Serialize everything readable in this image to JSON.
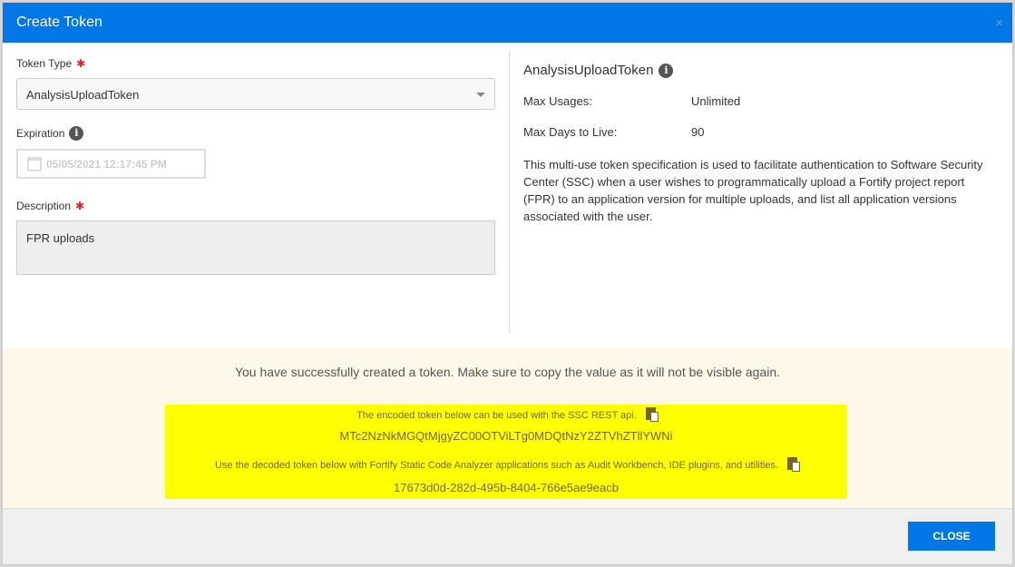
{
  "dialog": {
    "title": "Create Token",
    "close_icon": "×"
  },
  "form": {
    "token_type_label": "Token Type",
    "required_mark": "✱",
    "token_type_value": "AnalysisUploadToken",
    "expiration_label": "Expiration",
    "expiration_value": "05/05/2021 12:17:45 PM",
    "description_label": "Description",
    "description_value": "FPR uploads"
  },
  "details": {
    "title": "AnalysisUploadToken",
    "max_usages_label": "Max Usages:",
    "max_usages_value": "Unlimited",
    "max_days_label": "Max Days to Live:",
    "max_days_value": "90",
    "description": "This multi-use token specification is used to facilitate authentication to Software Security Center (SSC) when a user wishes to programmatically upload a Fortify project report (FPR) to an application version for multiple uploads, and list all application versions associated with the user."
  },
  "result": {
    "message": "You have successfully created a token. Make sure to copy the value as it will not be visible again.",
    "encoded_label": "The encoded token below can be used with the SSC REST api.",
    "encoded_token": "MTc2NzNkMGQtMjgyZC00OTViLTg0MDQtNzY2ZTVhZTllYWNi",
    "decoded_label": "Use the decoded token below with Fortify Static Code Analyzer applications such as Audit Workbench, IDE plugins, and utilities.",
    "decoded_token": "17673d0d-282d-495b-8404-766e5ae9eacb"
  },
  "footer": {
    "close_label": "CLOSE"
  }
}
